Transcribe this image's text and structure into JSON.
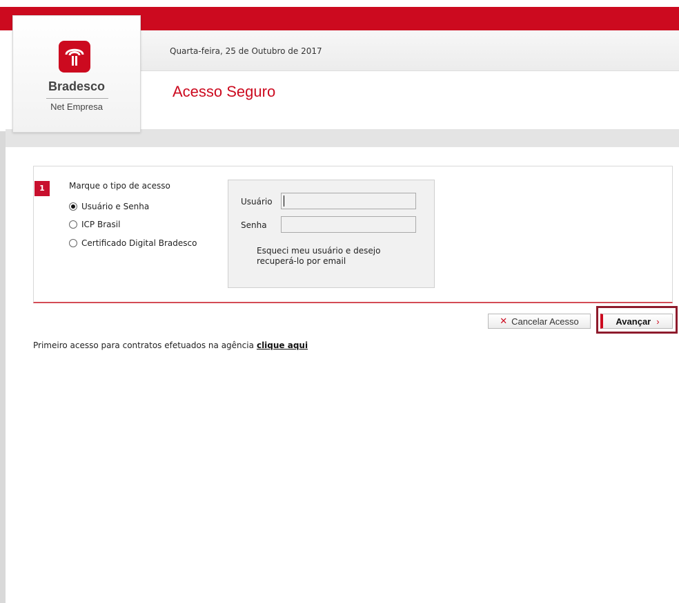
{
  "header": {
    "date": "Quarta-feira, 25 de Outubro de 2017",
    "page_title": "Acesso Seguro"
  },
  "logo": {
    "brand": "Bradesco",
    "sub": "Net Empresa",
    "icon": "bradesco-tree-icon"
  },
  "access": {
    "step": "1",
    "label": "Marque o tipo de acesso",
    "options": [
      {
        "label": "Usuário e Senha",
        "selected": true
      },
      {
        "label": "ICP Brasil",
        "selected": false
      },
      {
        "label": "Certificado Digital Bradesco",
        "selected": false
      }
    ]
  },
  "login": {
    "user_label": "Usuário",
    "user_value": "",
    "password_label": "Senha",
    "password_value": "",
    "forgot_link": "Esqueci meu usuário e desejo recuperá-lo por email"
  },
  "actions": {
    "cancel_label": "Cancelar Acesso",
    "cancel_icon": "close-icon",
    "next_label": "Avançar",
    "next_icon": "chevron-right-icon"
  },
  "footer": {
    "first_access_text": "Primeiro acesso para contratos efetuados na agência",
    "first_access_link": "clique aqui"
  },
  "colors": {
    "brand_red": "#cc0a1f",
    "highlight": "#8e1b2c"
  }
}
